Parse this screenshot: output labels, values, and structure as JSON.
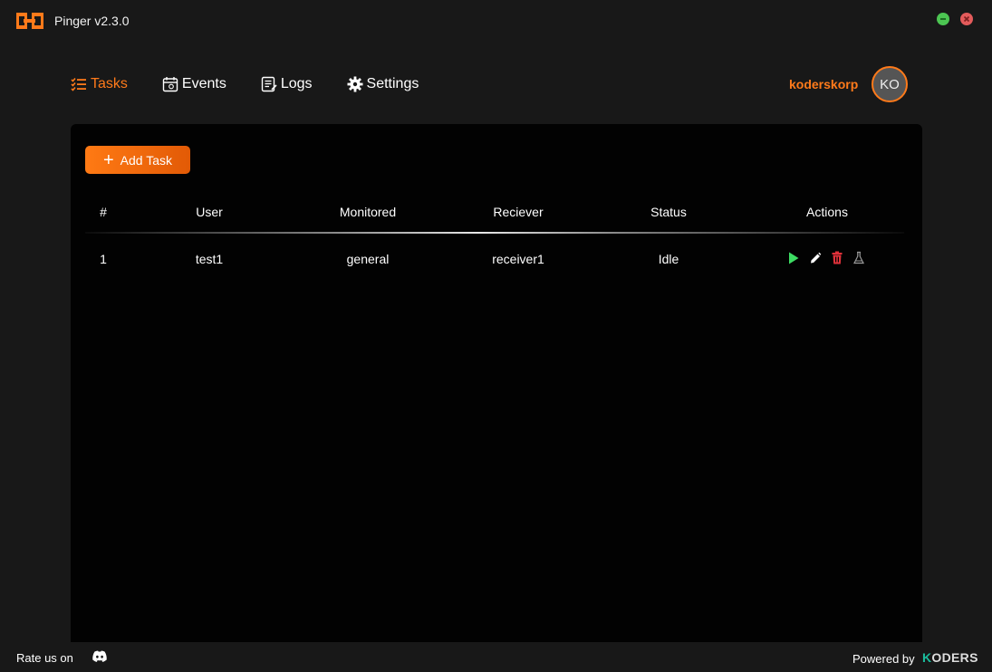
{
  "window": {
    "title": "Pinger v2.3.0",
    "controls": [
      "minimize",
      "close"
    ]
  },
  "nav": {
    "items": [
      {
        "label": "Tasks",
        "icon": "list-check-icon",
        "active": true
      },
      {
        "label": "Events",
        "icon": "calendar-icon",
        "active": false
      },
      {
        "label": "Logs",
        "icon": "log-icon",
        "active": false
      },
      {
        "label": "Settings",
        "icon": "gear-icon",
        "active": false
      }
    ]
  },
  "user": {
    "name": "koderskorp",
    "initials": "KO"
  },
  "toolbar": {
    "add_task_label": "Add Task"
  },
  "table": {
    "headers": [
      "#",
      "User",
      "Monitored",
      "Reciever",
      "Status",
      "Actions"
    ],
    "rows": [
      {
        "id": "1",
        "user": "test1",
        "monitored": "general",
        "receiver": "receiver1",
        "status": "Idle",
        "actions": [
          "play-icon",
          "edit-icon",
          "delete-icon",
          "test-flask-icon"
        ]
      }
    ]
  },
  "footer": {
    "rate_label": "Rate us on",
    "rate_icon": "discord-icon",
    "powered_label": "Powered by",
    "brand_k": "K",
    "brand_rest": "ODERS"
  },
  "colors": {
    "accent": "#ff7a1a",
    "background": "#181818",
    "panel": "#020202",
    "play": "#3ddc63",
    "delete": "#e0313a",
    "minimize": "#4cc552",
    "close": "#e35b5b"
  }
}
